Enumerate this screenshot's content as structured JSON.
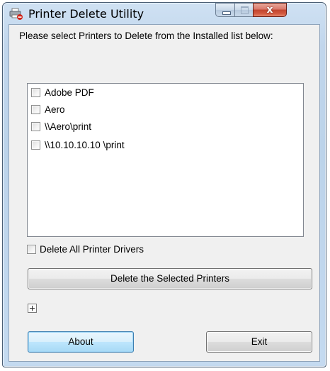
{
  "window": {
    "title": "Printer Delete Utility",
    "app_icon": "printer-delete-icon",
    "controls": {
      "minimize_icon": "minimize-icon",
      "maximize_icon": "maximize-icon",
      "close_glyph": "x"
    }
  },
  "main": {
    "prompt": "Please select Printers to Delete from the Installed list below:",
    "printers": [
      {
        "label": "Adobe PDF",
        "checked": false
      },
      {
        "label": "Aero",
        "checked": false
      },
      {
        "label": "\\\\Aero\\print",
        "checked": false
      },
      {
        "label": "\\\\10.10.10.10 \\print",
        "checked": false
      }
    ],
    "delete_all_drivers": {
      "label": "Delete All Printer Drivers",
      "checked": false
    },
    "delete_button": "Delete the Selected Printers",
    "expand_icon": "plus-icon"
  },
  "footer": {
    "about_button": "About",
    "exit_button": "Exit"
  },
  "colors": {
    "frame": "#c1d6ec",
    "client": "#f0f0f0",
    "close_button": "#c2452f",
    "default_button": "#bee6fd"
  }
}
